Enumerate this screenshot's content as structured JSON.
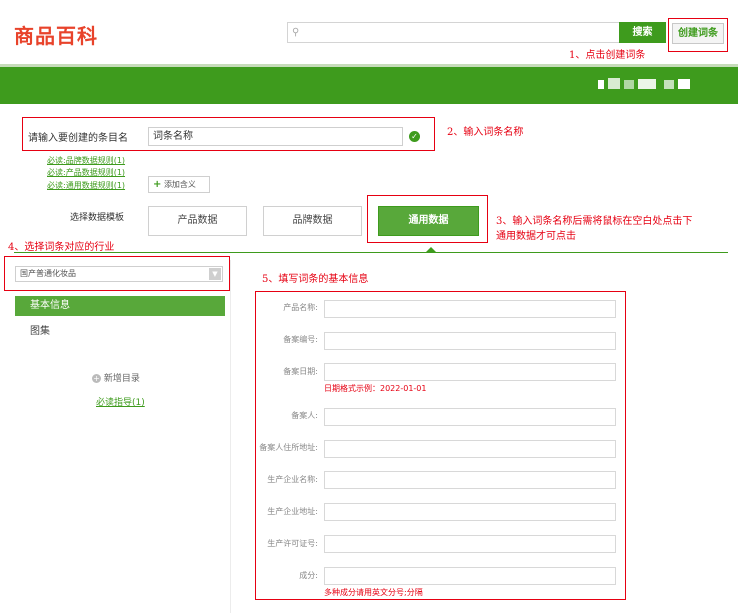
{
  "header": {
    "logo": "商品百科",
    "search_placeholder": "",
    "search_button": "搜索",
    "create_button": "创建词条"
  },
  "annotations": {
    "step1": "1、点击创建词条",
    "step2": "2、输入词条名称",
    "step3_line1": "3、输入词条名称后需将鼠标在空白处点击下",
    "step3_line2": "通用数据才可点击",
    "step4": "4、选择词条对应的行业",
    "step5": "5、填写词条的基本信息"
  },
  "entry": {
    "label": "请输入要创建的条目名",
    "value": "词条名称",
    "rules": [
      "必读:品牌数据规则(1)",
      "必读:产品数据规则(1)",
      "必读:通用数据规则(1)"
    ],
    "add_meaning": "添加含义"
  },
  "template": {
    "label": "选择数据模板",
    "options": [
      "产品数据",
      "品牌数据",
      "通用数据"
    ],
    "selected": "通用数据"
  },
  "industry": {
    "selected": "国产普通化妆品"
  },
  "sidebar": {
    "items": [
      "基本信息",
      "图集"
    ],
    "add_dir": "新增目录",
    "guide": "必读指导(1)"
  },
  "form": {
    "fields": [
      {
        "label": "产品名称:",
        "value": ""
      },
      {
        "label": "备案编号:",
        "value": ""
      },
      {
        "label": "备案日期:",
        "value": "",
        "hint": "日期格式示例：2022-01-01"
      },
      {
        "label": "备案人:",
        "value": ""
      },
      {
        "label": "备案人住所地址:",
        "value": ""
      },
      {
        "label": "生产企业名称:",
        "value": ""
      },
      {
        "label": "生产企业地址:",
        "value": ""
      },
      {
        "label": "生产许可证号:",
        "value": ""
      },
      {
        "label": "成分:",
        "value": "",
        "hint": "多种成分请用英文分号;分隔"
      }
    ]
  },
  "colors": {
    "brand_green": "#3e9b1d",
    "annotation_red": "#e60012",
    "logo_red": "#e8432b"
  }
}
